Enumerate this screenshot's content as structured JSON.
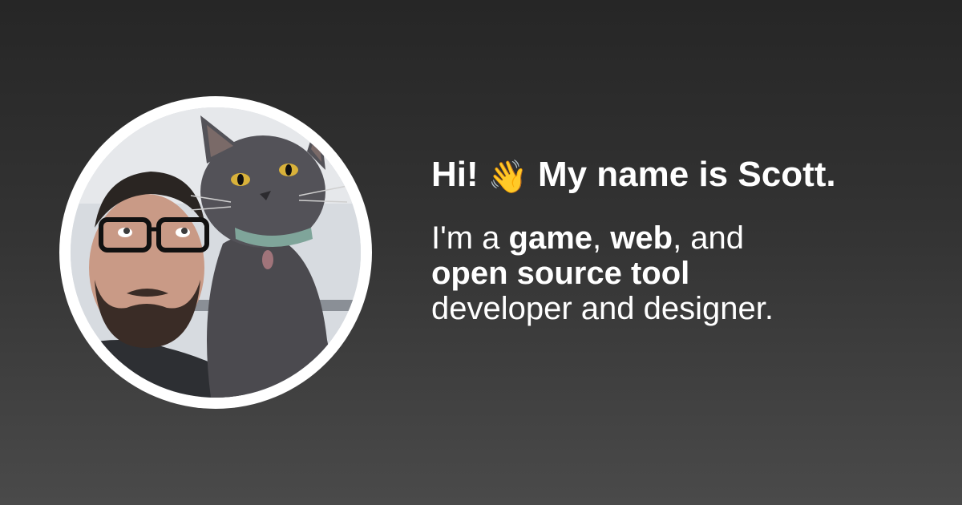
{
  "avatar": {
    "icon": "photo-person-with-cat",
    "ring_color": "#ffffff"
  },
  "greeting": {
    "pre": "Hi!",
    "icon": "waving-hand-icon",
    "wave_glyph": "👋",
    "post": "My name is Scott."
  },
  "bio": {
    "line1": {
      "t1": "I'm a ",
      "b1": "game",
      "t2": ", ",
      "b2": "web",
      "t3": ", and"
    },
    "line2": {
      "b1": "open source tool"
    },
    "line3": {
      "t1": "developer and designer."
    }
  },
  "colors": {
    "background_top": "#262626",
    "background_bottom": "#4a4a4a",
    "text": "#ffffff"
  }
}
